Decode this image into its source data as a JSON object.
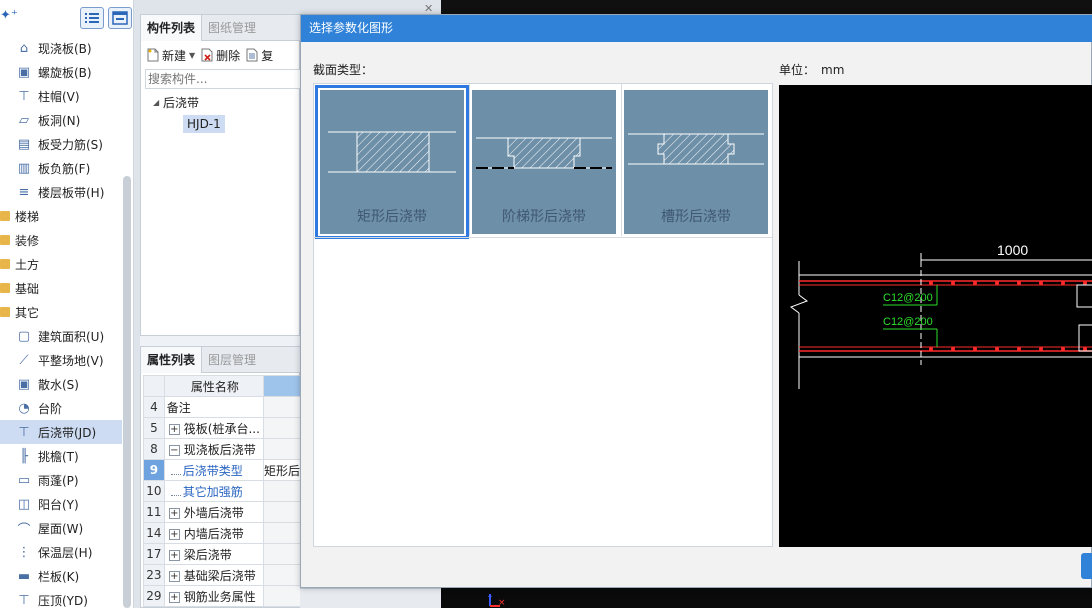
{
  "left_toolbar": {
    "small_icon": "sparkle-plus-icon"
  },
  "left_tree": [
    {
      "label": "现浇板(B)",
      "level": "child",
      "icon": "cast-slab-icon"
    },
    {
      "label": "螺旋板(B)",
      "level": "child",
      "icon": "spiral-slab-icon"
    },
    {
      "label": "柱帽(V)",
      "level": "child",
      "icon": "column-cap-icon"
    },
    {
      "label": "板洞(N)",
      "level": "child",
      "icon": "slab-hole-icon"
    },
    {
      "label": "板受力筋(S)",
      "level": "child",
      "icon": "slab-rebar-icon"
    },
    {
      "label": "板负筋(F)",
      "level": "child",
      "icon": "slab-neg-rebar-icon"
    },
    {
      "label": "楼层板带(H)",
      "level": "child",
      "icon": "floor-strip-icon"
    },
    {
      "label": "楼梯",
      "level": "folder",
      "icon": "folder-icon"
    },
    {
      "label": "装修",
      "level": "folder",
      "icon": "folder-icon"
    },
    {
      "label": "土方",
      "level": "folder",
      "icon": "folder-icon"
    },
    {
      "label": "基础",
      "level": "folder",
      "icon": "folder-icon"
    },
    {
      "label": "其它",
      "level": "folder",
      "icon": "folder-open-icon"
    },
    {
      "label": "建筑面积(U)",
      "level": "child",
      "icon": "building-area-icon"
    },
    {
      "label": "平整场地(V)",
      "level": "child",
      "icon": "site-leveling-icon"
    },
    {
      "label": "散水(S)",
      "level": "child",
      "icon": "apron-icon"
    },
    {
      "label": "台阶",
      "level": "child",
      "icon": "steps-icon"
    },
    {
      "label": "后浇带(JD)",
      "level": "child",
      "icon": "post-cast-strip-icon",
      "selected": true
    },
    {
      "label": "挑檐(T)",
      "level": "child",
      "icon": "eave-icon"
    },
    {
      "label": "雨蓬(P)",
      "level": "child",
      "icon": "canopy-icon"
    },
    {
      "label": "阳台(Y)",
      "level": "child",
      "icon": "balcony-icon"
    },
    {
      "label": "屋面(W)",
      "level": "child",
      "icon": "roof-icon"
    },
    {
      "label": "保温层(H)",
      "level": "child",
      "icon": "insulation-icon"
    },
    {
      "label": "栏板(K)",
      "level": "child",
      "icon": "parapet-icon"
    },
    {
      "label": "压顶(YD)",
      "level": "child",
      "icon": "coping-icon"
    }
  ],
  "component_panel": {
    "tabs": [
      "构件列表",
      "图纸管理"
    ],
    "toolbar": {
      "new_label": "新建",
      "delete_label": "删除",
      "copy_label": "复"
    },
    "search_placeholder": "搜索构件...",
    "tree_parent": "后浇带",
    "tree_child": "HJD-1"
  },
  "property_panel": {
    "tabs": [
      "属性列表",
      "图层管理"
    ],
    "header_name": "属性名称",
    "rows": [
      {
        "num": "4",
        "name": "备注",
        "expander": "",
        "sub": false,
        "value": ""
      },
      {
        "num": "5",
        "name": "筏板(桩承台...",
        "expander": "+",
        "sub": false,
        "value": ""
      },
      {
        "num": "8",
        "name": "现浇板后浇带",
        "expander": "−",
        "sub": false,
        "value": ""
      },
      {
        "num": "9",
        "name": "后浇带类型",
        "expander": "",
        "sub": true,
        "value": "矩形后",
        "selected": true
      },
      {
        "num": "10",
        "name": "其它加强筋",
        "expander": "",
        "sub": true,
        "value": ""
      },
      {
        "num": "11",
        "name": "外墙后浇带",
        "expander": "+",
        "sub": false,
        "value": ""
      },
      {
        "num": "14",
        "name": "内墙后浇带",
        "expander": "+",
        "sub": false,
        "value": ""
      },
      {
        "num": "17",
        "name": "梁后浇带",
        "expander": "+",
        "sub": false,
        "value": ""
      },
      {
        "num": "23",
        "name": "基础梁后浇带",
        "expander": "+",
        "sub": false,
        "value": ""
      },
      {
        "num": "29",
        "name": "钢筋业务属性",
        "expander": "+",
        "sub": false,
        "value": ""
      }
    ]
  },
  "dialog": {
    "title": "选择参数化图形",
    "section_label": "截面类型：",
    "unit_label": "单位：",
    "unit_value": "mm",
    "cards": [
      {
        "label": "矩形后浇带",
        "selected": true
      },
      {
        "label": "阶梯形后浇带",
        "selected": false
      },
      {
        "label": "槽形后浇带",
        "selected": false
      }
    ],
    "preview": {
      "dimension": "1000",
      "rebar_top": "C12@200",
      "rebar_bottom": "C12@200"
    }
  },
  "colors": {
    "title_bar": "#2f82d8",
    "card_fill": "#6e8fa8",
    "selection": "#2f7ae0",
    "cad_rebar": "#ff2a2a",
    "cad_annotation": "#2dde2d"
  }
}
